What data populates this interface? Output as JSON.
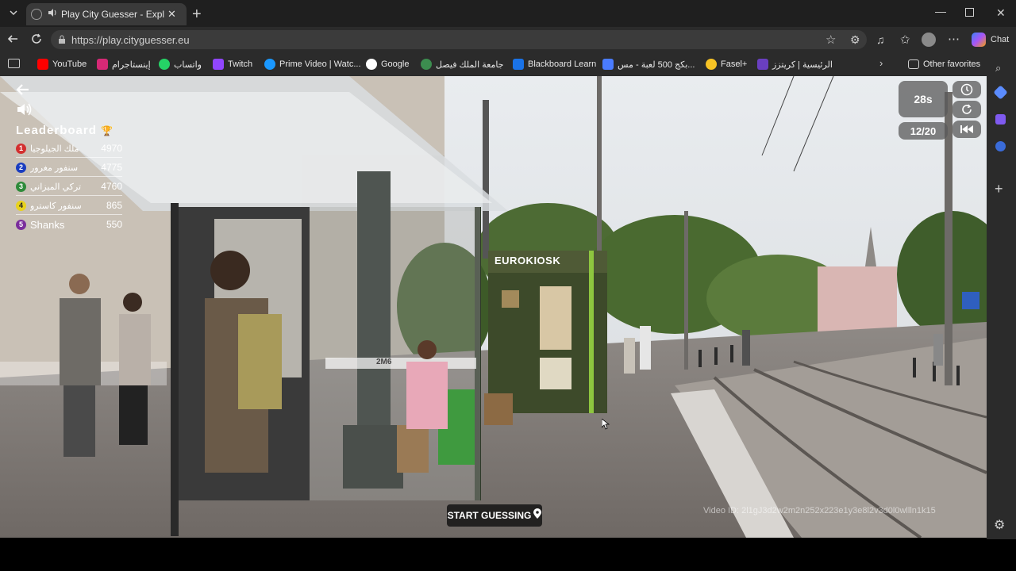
{
  "browser": {
    "tab_title": "Play City Guesser - Explore th",
    "url": "https://play.cityguesser.eu",
    "chat_label": "Chat",
    "favorites": [
      {
        "label": "YouTube",
        "color": "#ff0000"
      },
      {
        "label": "إينستاجرام",
        "color": "#d62976"
      },
      {
        "label": "واتساب",
        "color": "#25d366"
      },
      {
        "label": "Twitch",
        "color": "#9146ff"
      },
      {
        "label": "Prime Video | Watc...",
        "color": "#1a98ff"
      },
      {
        "label": "Google",
        "color": "#ffffff"
      },
      {
        "label": "جامعة الملك فيصل",
        "color": "#3c8d4f"
      },
      {
        "label": "Blackboard Learn",
        "color": "#1a73e8"
      },
      {
        "label": "بكج 500 لعبة - مس...",
        "color": "#4a7cff"
      },
      {
        "label": "Fasel+",
        "color": "#f7c325"
      },
      {
        "label": "الرئيسية | كريتزز",
        "color": "#6a3fc1"
      }
    ],
    "other_favorites": "Other favorites"
  },
  "game": {
    "leaderboard_title": "Leaderboard",
    "trophy": "🏆",
    "players": [
      {
        "rank": "1",
        "name": "ملك الجيلوجيا",
        "score": "4970",
        "color": "#d32f2f"
      },
      {
        "rank": "2",
        "name": "سنفور مغرور",
        "score": "4775",
        "color": "#1a3dc0"
      },
      {
        "rank": "3",
        "name": "تركي الميزاني",
        "score": "4760",
        "color": "#2e8b3a"
      },
      {
        "rank": "4",
        "name": "سنفور كاسترو",
        "score": "865",
        "color": "#e8d21d"
      },
      {
        "rank": "5",
        "name": "Shanks",
        "score": "550",
        "color": "#7a2d9c"
      }
    ],
    "timer": "28s",
    "round": "12/20",
    "start_label": "START GUESSING",
    "video_id": "Video ID: 2l1gJ3d2w2m2n252x223e1y3e8l2v3d0l0wllln1k15",
    "kiosk_sign": "EUROKIOSK",
    "shelter_code": "2M6"
  }
}
